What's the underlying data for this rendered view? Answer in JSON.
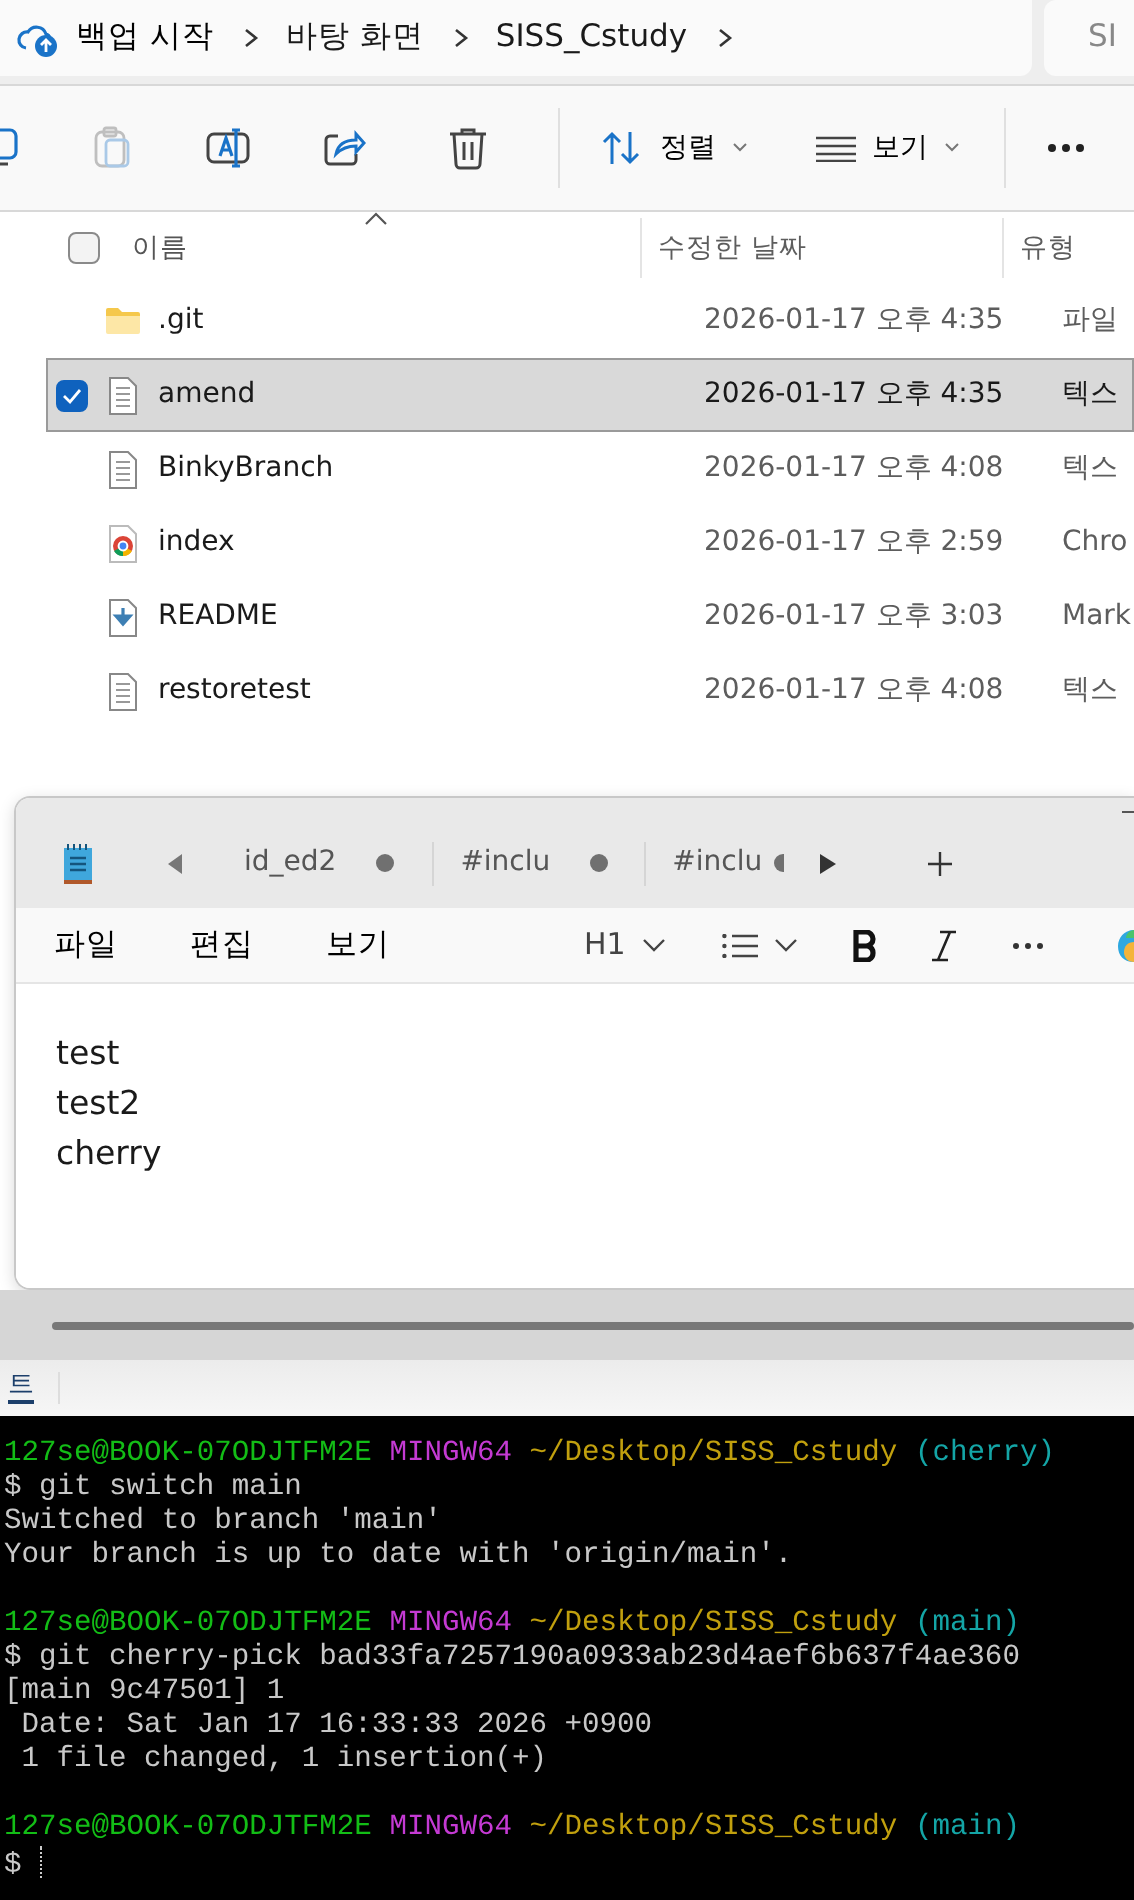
{
  "address_bar": {
    "backup_label": "백업 시작",
    "breadcrumbs": [
      "바탕 화면",
      "SISS_Cstudy"
    ],
    "search_text": "SI"
  },
  "toolbar": {
    "icons": [
      {
        "kind": "copy",
        "disabled": false
      },
      {
        "kind": "paste",
        "disabled": true
      },
      {
        "kind": "rename",
        "disabled": false
      },
      {
        "kind": "share",
        "disabled": false
      },
      {
        "kind": "delete",
        "disabled": false
      }
    ],
    "sort_label": "정렬",
    "view_label": "보기"
  },
  "file_list": {
    "select_all_checked": false,
    "columns": [
      "이름",
      "수정한 날짜",
      "유형"
    ],
    "files": [
      {
        "name": ".git",
        "modified": "2026-01-17 오후 4:35",
        "type": "파일",
        "kind": "folder",
        "selected": false
      },
      {
        "name": "amend",
        "modified": "2026-01-17 오후 4:35",
        "type": "텍스",
        "kind": "text",
        "selected": true
      },
      {
        "name": "BinkyBranch",
        "modified": "2026-01-17 오후 4:08",
        "type": "텍스",
        "kind": "text",
        "selected": false
      },
      {
        "name": "index",
        "modified": "2026-01-17 오후 2:59",
        "type": "Chro",
        "kind": "chrome",
        "selected": false
      },
      {
        "name": "README",
        "modified": "2026-01-17 오후 3:03",
        "type": "Mark",
        "kind": "markdown",
        "selected": false
      },
      {
        "name": "restoretest",
        "modified": "2026-01-17 오후 4:08",
        "type": "텍스",
        "kind": "text",
        "selected": false
      }
    ]
  },
  "notepad": {
    "tabs": [
      {
        "label": "id_ed2",
        "unsaved": true
      },
      {
        "label": "#inclu",
        "unsaved": true
      },
      {
        "label": "#inclu",
        "unsaved": true
      }
    ],
    "menu": [
      "파일",
      "편집",
      "보기"
    ],
    "heading_label": "H1",
    "content": [
      "test",
      "test2",
      "cherry"
    ]
  },
  "background_fragment": "트",
  "terminal": {
    "lines": [
      {
        "kind": "prompt",
        "user": "127se@BOOK-07ODJTFM2E",
        "shell": "MINGW64",
        "path": "~/Desktop/SISS_Cstudy",
        "branch": "(cherry)"
      },
      {
        "kind": "output",
        "text": "$ git switch main"
      },
      {
        "kind": "output",
        "text": "Switched to branch 'main'"
      },
      {
        "kind": "output",
        "text": "Your branch is up to date with 'origin/main'."
      },
      {
        "kind": "blank"
      },
      {
        "kind": "prompt",
        "user": "127se@BOOK-07ODJTFM2E",
        "shell": "MINGW64",
        "path": "~/Desktop/SISS_Cstudy",
        "branch": "(main)"
      },
      {
        "kind": "output",
        "text": "$ git cherry-pick bad33fa7257190a0933ab23d4aef6b637f4ae360"
      },
      {
        "kind": "output",
        "text": "[main 9c47501] 1"
      },
      {
        "kind": "output",
        "text": " Date: Sat Jan 17 16:33:33 2026 +0900"
      },
      {
        "kind": "output",
        "text": " 1 file changed, 1 insertion(+)"
      },
      {
        "kind": "blank"
      },
      {
        "kind": "prompt",
        "user": "127se@BOOK-07ODJTFM2E",
        "shell": "MINGW64",
        "path": "~/Desktop/SISS_Cstudy",
        "branch": "(main)"
      },
      {
        "kind": "input",
        "text": "$ "
      }
    ]
  }
}
